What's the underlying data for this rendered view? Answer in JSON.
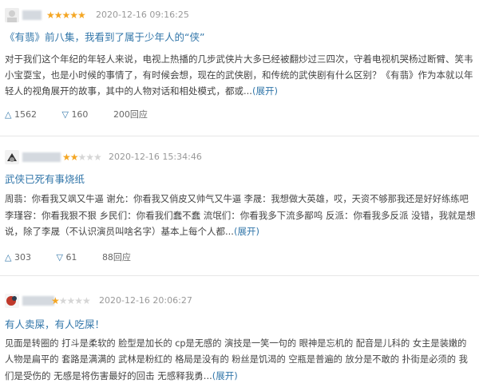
{
  "reviews": [
    {
      "date": "2020-12-16 09:16:25",
      "rating": 5,
      "title": "《有翡》前八集，我看到了属于少年人的“侠”",
      "lines": [
        "对于我们这个年纪的年轻人来说，电视上热播的几步武侠片大多已经被翻炒过三四次，守着电视机哭杨过断臂、笑韦",
        "小宝耍宝，也是小时候的事情了，有时候会想，现在的武侠剧，和传统的武侠剧有什么区别？《有翡》作为本就以年",
        "轻人的视角展开的故事，其中的人物对话和相处模式，都或..."
      ],
      "expand": "(展开)",
      "up": "1562",
      "down": "160",
      "replies": "200回应"
    },
    {
      "date": "2020-12-16 15:34:46",
      "rating": 2,
      "title": "武侠已死有事烧纸",
      "lines": [
        "周翡：你看我又飒又牛逼 谢允：你看我又俏皮又帅气又牛逼 李晟：我想做大英雄，哎，天资不够那我还是好好练练吧",
        "李瑾容：你看我狠不狠 乡民们：你看我们蠢不蠢 流氓们：你看我多下流多鄙呜 反派：你看我多反派 没错，我就是想",
        "说，除了李晟（不认识演员叫啥名字）基本上每个人都..."
      ],
      "expand": "(展开)",
      "up": "303",
      "down": "61",
      "replies": "88回应"
    },
    {
      "date": "2020-12-16 20:06:27",
      "rating": 1,
      "title": "有人卖屎，有人吃屎！",
      "lines": [
        "见面是转圈的 打斗是柔软的 脸型是加长的 cp是无感的 演技是一笑一句的 眼神是忘机的 配音是儿科的 女主是装嫩的",
        "人物是扁平的 套路是满满的 武林是粉红的 格局是没有的 粉丝是饥渴的 空瓶是普遍的 放分是不敢的 扑街是必须的 我",
        "们是受伤的 无感是将伤害最好的回击 无感释我勇..."
      ],
      "expand": "(展开)"
    }
  ]
}
